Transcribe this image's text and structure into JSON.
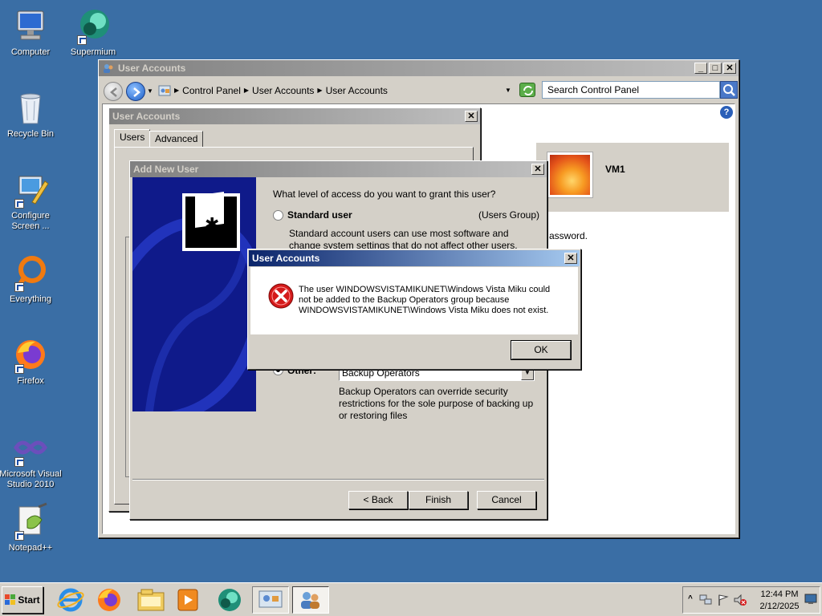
{
  "desktop": {
    "icons": [
      {
        "label": "Computer",
        "icon": "computer-icon"
      },
      {
        "label": "Supermium",
        "icon": "supermium-icon"
      },
      {
        "label": "Recycle Bin",
        "icon": "recycle-bin-icon"
      },
      {
        "label": "Configure Screen ...",
        "icon": "configure-screen-icon"
      },
      {
        "label": "Everything",
        "icon": "everything-icon"
      },
      {
        "label": "Firefox",
        "icon": "firefox-icon"
      },
      {
        "label": "Microsoft Visual Studio 2010",
        "icon": "visual-studio-icon"
      },
      {
        "label": "Notepad++",
        "icon": "notepadpp-icon"
      }
    ]
  },
  "explorer": {
    "title": "User Accounts",
    "breadcrumb": [
      "Control Panel",
      "User Accounts",
      "User Accounts"
    ],
    "search_placeholder": "Search Control Panel",
    "account_name": "VM1",
    "password_fragment": "assword."
  },
  "ua_dialog": {
    "title": "User Accounts",
    "tabs": [
      "Users",
      "Advanced"
    ]
  },
  "wizard": {
    "title": "Add New User",
    "question": "What level of access do you want to grant this user?",
    "standard_label": "Standard user",
    "standard_group": "(Users Group)",
    "standard_desc": "Standard account users can use most software and change system settings that do not affect other users.",
    "other_label": "Other:",
    "other_value": "Backup Operators",
    "other_desc": "Backup Operators can override security restrictions for the sole purpose of backing up or restoring files",
    "back_label": "< Back",
    "finish_label": "Finish",
    "cancel_label": "Cancel"
  },
  "error_dialog": {
    "title": "User Accounts",
    "message": "The user WINDOWSVISTAMIKUNET\\Windows Vista Miku could not be added to the Backup Operators group because WINDOWSVISTAMIKUNET\\Windows Vista Miku does not exist.",
    "ok_label": "OK"
  },
  "taskbar": {
    "start_label": "Start",
    "time": "12:44 PM",
    "date": "2/12/2025"
  }
}
